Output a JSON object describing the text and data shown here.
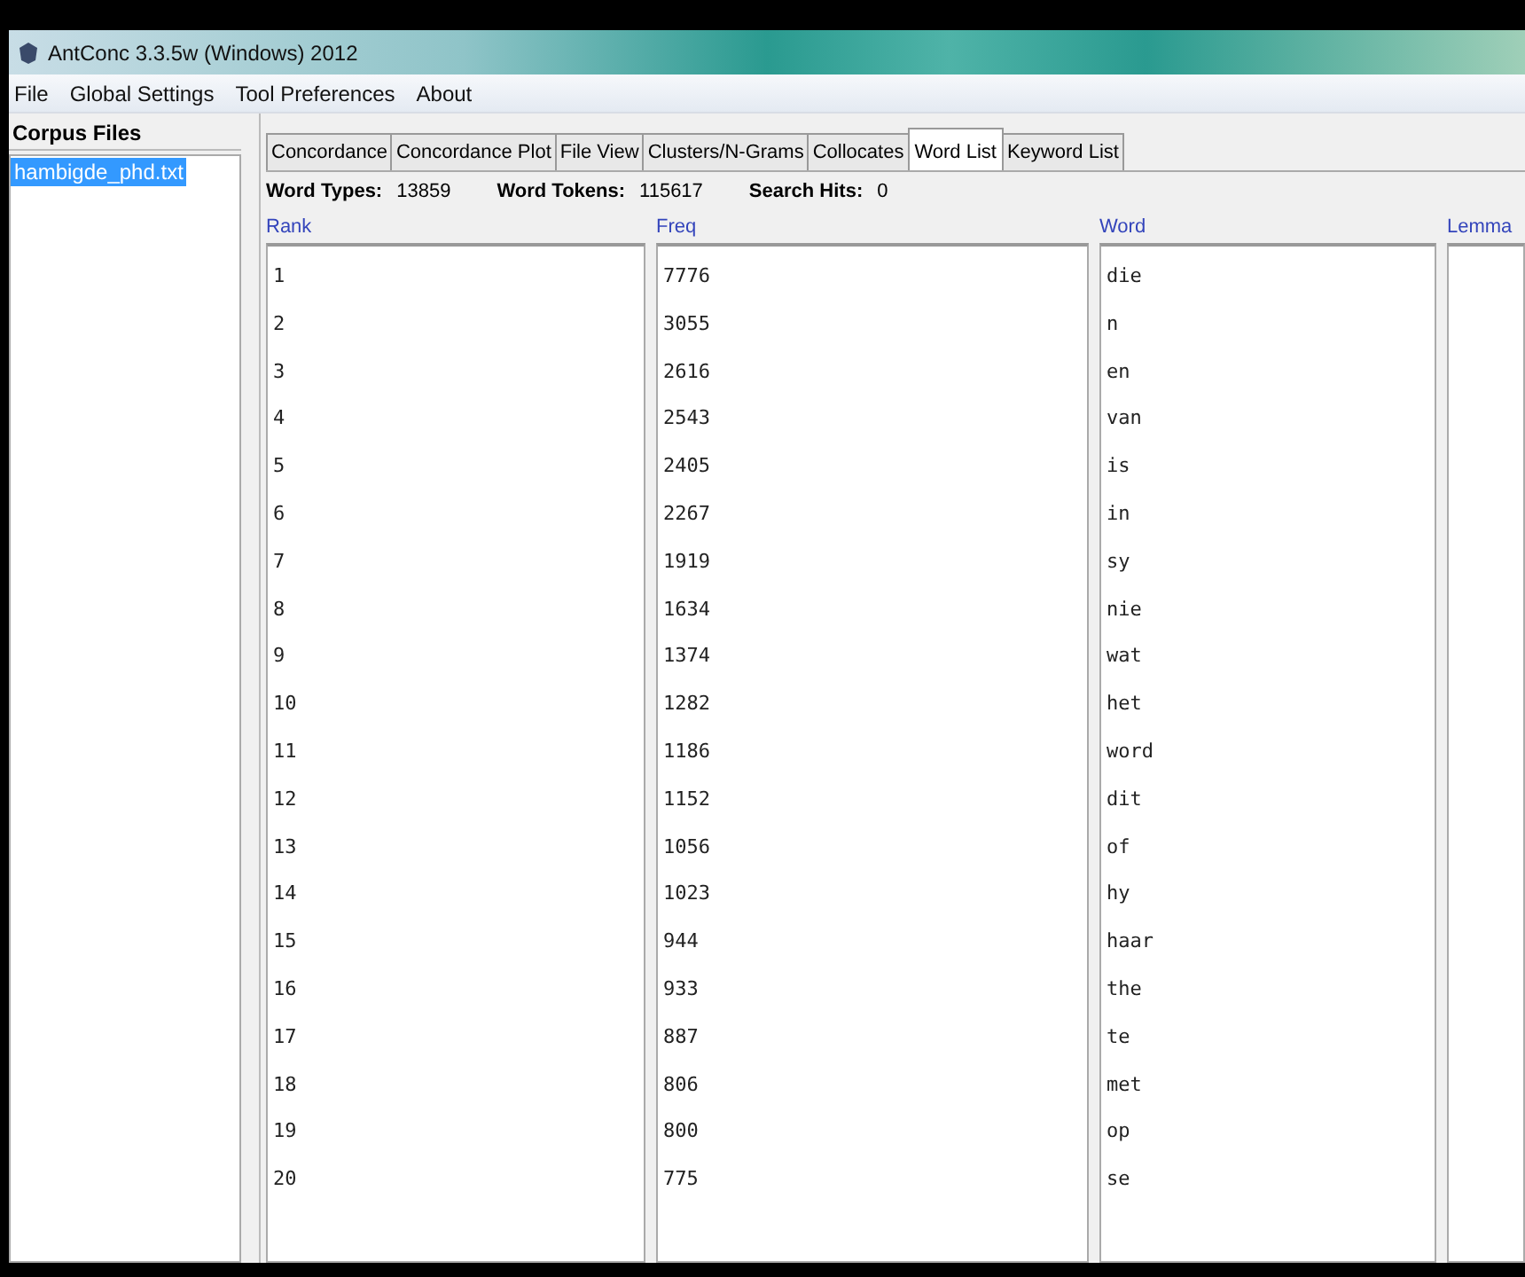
{
  "window": {
    "title": "AntConc 3.3.5w (Windows) 2012"
  },
  "menu": [
    "File",
    "Global Settings",
    "Tool Preferences",
    "About"
  ],
  "corpus_panel": {
    "title": "Corpus Files",
    "files": [
      {
        "name": "hambigde_phd.txt",
        "selected": true
      }
    ]
  },
  "tabs": [
    {
      "label": "Concordance",
      "selected": false
    },
    {
      "label": "Concordance Plot",
      "selected": false
    },
    {
      "label": "File View",
      "selected": false
    },
    {
      "label": "Clusters/N-Grams",
      "selected": false
    },
    {
      "label": "Collocates",
      "selected": false
    },
    {
      "label": "Word List",
      "selected": true
    },
    {
      "label": "Keyword List",
      "selected": false
    }
  ],
  "stats": [
    {
      "label": "Word Types:",
      "value": "13859"
    },
    {
      "label": "Word Tokens:",
      "value": "115617"
    },
    {
      "label": "Search Hits:",
      "value": "0"
    }
  ],
  "table": {
    "columns": [
      "Rank",
      "Freq",
      "Word",
      "Lemma"
    ],
    "rows": [
      {
        "rank": "1",
        "freq": "7776",
        "word": "die"
      },
      {
        "rank": "2",
        "freq": "3055",
        "word": "n"
      },
      {
        "rank": "3",
        "freq": "2616",
        "word": "en"
      },
      {
        "rank": "4",
        "freq": "2543",
        "word": "van"
      },
      {
        "rank": "5",
        "freq": "2405",
        "word": "is"
      },
      {
        "rank": "6",
        "freq": "2267",
        "word": "in"
      },
      {
        "rank": "7",
        "freq": "1919",
        "word": "sy"
      },
      {
        "rank": "8",
        "freq": "1634",
        "word": "nie"
      },
      {
        "rank": "9",
        "freq": "1374",
        "word": "wat"
      },
      {
        "rank": "10",
        "freq": "1282",
        "word": "het"
      },
      {
        "rank": "11",
        "freq": "1186",
        "word": "word"
      },
      {
        "rank": "12",
        "freq": "1152",
        "word": "dit"
      },
      {
        "rank": "13",
        "freq": "1056",
        "word": "of"
      },
      {
        "rank": "14",
        "freq": "1023",
        "word": "hy"
      },
      {
        "rank": "15",
        "freq": "944",
        "word": "haar"
      },
      {
        "rank": "16",
        "freq": "933",
        "word": "the"
      },
      {
        "rank": "17",
        "freq": "887",
        "word": "te"
      },
      {
        "rank": "18",
        "freq": "806",
        "word": "met"
      },
      {
        "rank": "19",
        "freq": "800",
        "word": "op"
      },
      {
        "rank": "20",
        "freq": "775",
        "word": "se"
      }
    ]
  }
}
